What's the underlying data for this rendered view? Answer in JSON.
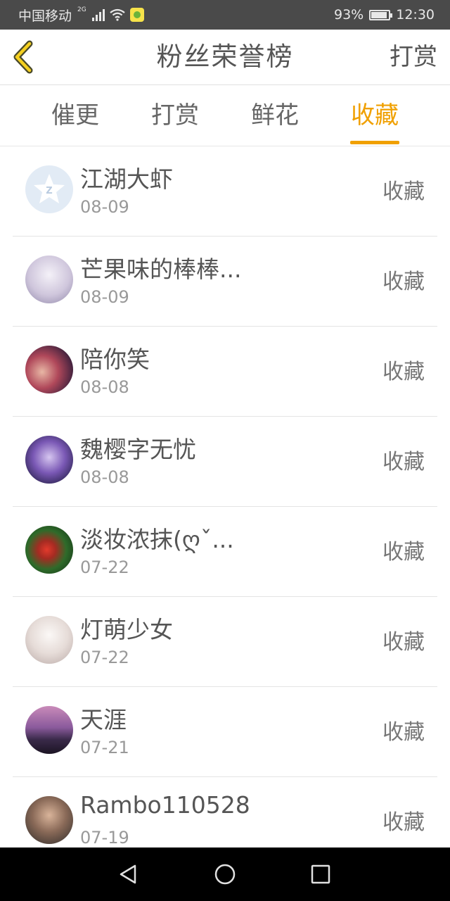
{
  "status_bar": {
    "carrier": "中国移动",
    "network": "2G",
    "battery": "93%",
    "battery_level": 0.93,
    "time": "12:30"
  },
  "header": {
    "title": "粉丝荣誉榜",
    "action_label": "打赏",
    "back_icon": "chevron-left-icon",
    "accent_color": "#f0a000"
  },
  "tabs": [
    {
      "label": "催更",
      "active": false
    },
    {
      "label": "打赏",
      "active": false
    },
    {
      "label": "鲜花",
      "active": false
    },
    {
      "label": "收藏",
      "active": true
    }
  ],
  "list": [
    {
      "name": "江湖大虾",
      "date": "08-09",
      "action": "收藏"
    },
    {
      "name": "芒果味的棒棒...",
      "date": "08-09",
      "action": "收藏"
    },
    {
      "name": "陪你笑",
      "date": "08-08",
      "action": "收藏"
    },
    {
      "name": "魏樱字无忧",
      "date": "08-08",
      "action": "收藏"
    },
    {
      "name": "淡妆浓抹(ღˇ...",
      "date": "07-22",
      "action": "收藏"
    },
    {
      "name": "灯萌少女",
      "date": "07-22",
      "action": "收藏"
    },
    {
      "name": "天涯",
      "date": "07-21",
      "action": "收藏"
    },
    {
      "name": "Rambo110528",
      "date": "07-19",
      "action": "收藏"
    }
  ],
  "nav": {
    "back_icon": "triangle-back-icon",
    "home_icon": "circle-home-icon",
    "recent_icon": "square-recent-icon"
  }
}
